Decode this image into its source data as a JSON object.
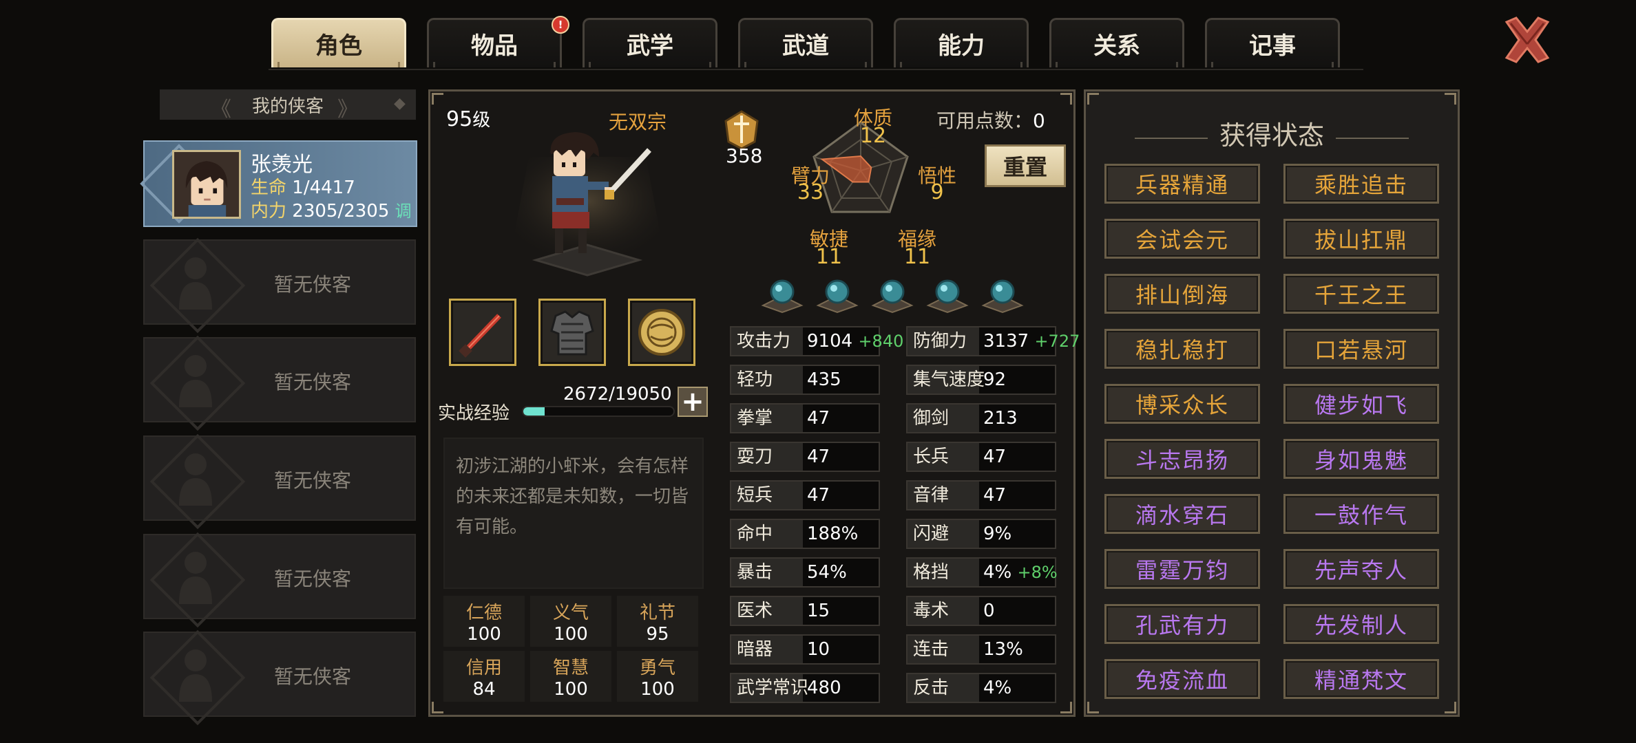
{
  "tabs": [
    {
      "label": "角色",
      "active": true,
      "notify": false
    },
    {
      "label": "物品",
      "active": false,
      "notify": true
    },
    {
      "label": "武学",
      "active": false,
      "notify": false
    },
    {
      "label": "武道",
      "active": false,
      "notify": false
    },
    {
      "label": "能力",
      "active": false,
      "notify": false
    },
    {
      "label": "关系",
      "active": false,
      "notify": false
    },
    {
      "label": "记事",
      "active": false,
      "notify": false
    }
  ],
  "notify_mark": "!",
  "roster": {
    "header": "我的侠客",
    "hero": {
      "name": "张羡光",
      "hp_label": "生命",
      "hp": "1/4417",
      "mp_label": "内力",
      "mp": "2305/2305",
      "adjust": "调"
    },
    "empty_slots": [
      "暂无侠客",
      "暂无侠客",
      "暂无侠客",
      "暂无侠客",
      "暂无侠客"
    ]
  },
  "character": {
    "level_num": "95",
    "level_suffix": "级",
    "sect": "无双宗",
    "power": "358",
    "exp": {
      "label": "实战经验",
      "value": "2672/19050",
      "fraction": 0.14,
      "plus": "+"
    },
    "description": "初涉江湖的小虾米，会有怎样的未来还都是未知数，一切皆有可能。",
    "equipment": [
      "sword-icon",
      "armor-icon",
      "accessory-icon"
    ],
    "virtues": [
      {
        "name": "仁德",
        "value": "100"
      },
      {
        "name": "义气",
        "value": "100"
      },
      {
        "name": "礼节",
        "value": "95"
      },
      {
        "name": "信用",
        "value": "84"
      },
      {
        "name": "智慧",
        "value": "100"
      },
      {
        "name": "勇气",
        "value": "100"
      }
    ]
  },
  "attributes": {
    "constitution": {
      "name": "体质",
      "value": "12"
    },
    "strength": {
      "name": "臂力",
      "value": "33"
    },
    "insight": {
      "name": "悟性",
      "value": "9"
    },
    "agility": {
      "name": "敏捷",
      "value": "11"
    },
    "luck": {
      "name": "福缘",
      "value": "11"
    },
    "points_label": "可用点数：",
    "points": "0",
    "reset": "重置",
    "orbs": 5
  },
  "stats_left": [
    {
      "label": "攻击力",
      "value": "9104",
      "bonus": "+840"
    },
    {
      "label": "轻功",
      "value": "435",
      "bonus": ""
    },
    {
      "label": "拳掌",
      "value": "47",
      "bonus": ""
    },
    {
      "label": "耍刀",
      "value": "47",
      "bonus": ""
    },
    {
      "label": "短兵",
      "value": "47",
      "bonus": ""
    },
    {
      "label": "命中",
      "value": "188%",
      "bonus": ""
    },
    {
      "label": "暴击",
      "value": "54%",
      "bonus": ""
    },
    {
      "label": "医术",
      "value": "15",
      "bonus": ""
    },
    {
      "label": "暗器",
      "value": "10",
      "bonus": ""
    },
    {
      "label": "武学常识",
      "value": "480",
      "bonus": ""
    }
  ],
  "stats_right": [
    {
      "label": "防御力",
      "value": "3137",
      "bonus": "+727"
    },
    {
      "label": "集气速度",
      "value": "92",
      "bonus": ""
    },
    {
      "label": "御剑",
      "value": "213",
      "bonus": ""
    },
    {
      "label": "长兵",
      "value": "47",
      "bonus": ""
    },
    {
      "label": "音律",
      "value": "47",
      "bonus": ""
    },
    {
      "label": "闪避",
      "value": "9%",
      "bonus": ""
    },
    {
      "label": "格挡",
      "value": "4%",
      "bonus": "+8%"
    },
    {
      "label": "毒术",
      "value": "0",
      "bonus": ""
    },
    {
      "label": "连击",
      "value": "13%",
      "bonus": ""
    },
    {
      "label": "反击",
      "value": "4%",
      "bonus": ""
    }
  ],
  "status_panel": {
    "title": "获得状态",
    "buffs": [
      {
        "text": "兵器精通",
        "tier": "gold"
      },
      {
        "text": "乘胜追击",
        "tier": "gold"
      },
      {
        "text": "会试会元",
        "tier": "gold"
      },
      {
        "text": "拔山扛鼎",
        "tier": "gold"
      },
      {
        "text": "排山倒海",
        "tier": "gold"
      },
      {
        "text": "千王之王",
        "tier": "gold"
      },
      {
        "text": "稳扎稳打",
        "tier": "gold"
      },
      {
        "text": "口若悬河",
        "tier": "gold"
      },
      {
        "text": "博采众长",
        "tier": "gold"
      },
      {
        "text": "健步如飞",
        "tier": "purple"
      },
      {
        "text": "斗志昂扬",
        "tier": "purple"
      },
      {
        "text": "身如鬼魅",
        "tier": "purple"
      },
      {
        "text": "滴水穿石",
        "tier": "purple"
      },
      {
        "text": "一鼓作气",
        "tier": "purple"
      },
      {
        "text": "雷霆万钧",
        "tier": "purple"
      },
      {
        "text": "先声夺人",
        "tier": "purple"
      },
      {
        "text": "孔武有力",
        "tier": "purple"
      },
      {
        "text": "先发制人",
        "tier": "purple"
      },
      {
        "text": "免疫流血",
        "tier": "purple"
      },
      {
        "text": "精通梵文",
        "tier": "purple"
      }
    ]
  },
  "colors": {
    "gold_text": "#e6a53a",
    "purple_text": "#b978f0",
    "bonus_green": "#5fd06b",
    "hero_slot": "#5f7c96"
  }
}
